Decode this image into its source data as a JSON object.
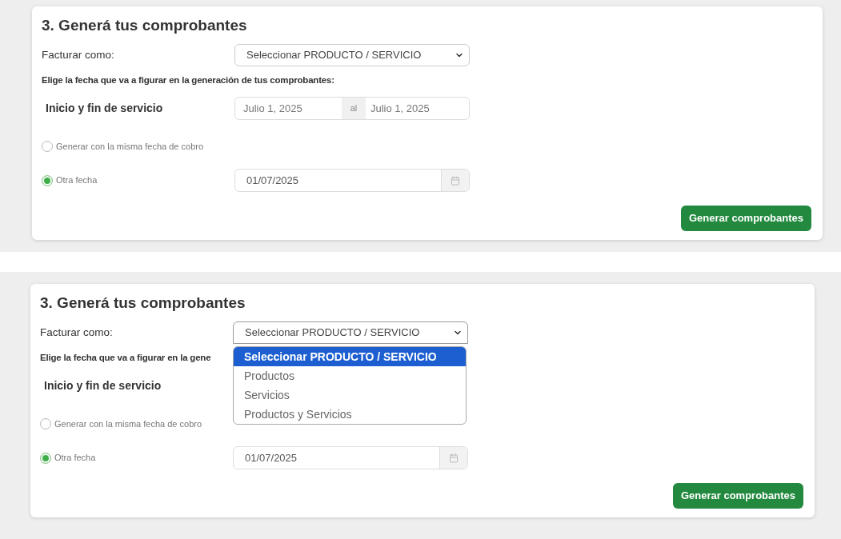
{
  "panels": [
    {
      "title": "3. Generá tus comprobantes",
      "invoice_as": {
        "label": "Facturar como:",
        "value": "Seleccionar PRODUCTO / SERVICIO",
        "expanded": false
      },
      "date_prompt": "Elige la fecha que va a figurar en la generación de tus comprobantes:",
      "service_period": {
        "label": "Inicio y fin de servicio",
        "start": "Julio 1, 2025",
        "separator": "al",
        "end": "Julio 1, 2025"
      },
      "radios": [
        {
          "label": "Generar con la misma fecha de cobro",
          "selected": false
        },
        {
          "label": "Otra fecha",
          "selected": true
        }
      ],
      "date_field": {
        "value": "01/07/2025"
      },
      "button": "Generar comprobantes"
    },
    {
      "title": "3. Generá tus comprobantes",
      "invoice_as": {
        "label": "Facturar como:",
        "value": "Seleccionar PRODUCTO / SERVICIO",
        "expanded": true,
        "options": [
          {
            "label": "Seleccionar PRODUCTO / SERVICIO",
            "selected": true
          },
          {
            "label": "Productos",
            "selected": false
          },
          {
            "label": "Servicios",
            "selected": false
          },
          {
            "label": "Productos y Servicios",
            "selected": false
          }
        ]
      },
      "date_prompt": "Elige la fecha que va a figurar en la gene",
      "service_period": {
        "label": "Inicio y fin de servicio"
      },
      "radios": [
        {
          "label": "Generar con la misma fecha de cobro",
          "selected": false
        },
        {
          "label": "Otra fecha",
          "selected": true
        }
      ],
      "date_field": {
        "value": "01/07/2025"
      },
      "button": "Generar comprobantes"
    }
  ]
}
